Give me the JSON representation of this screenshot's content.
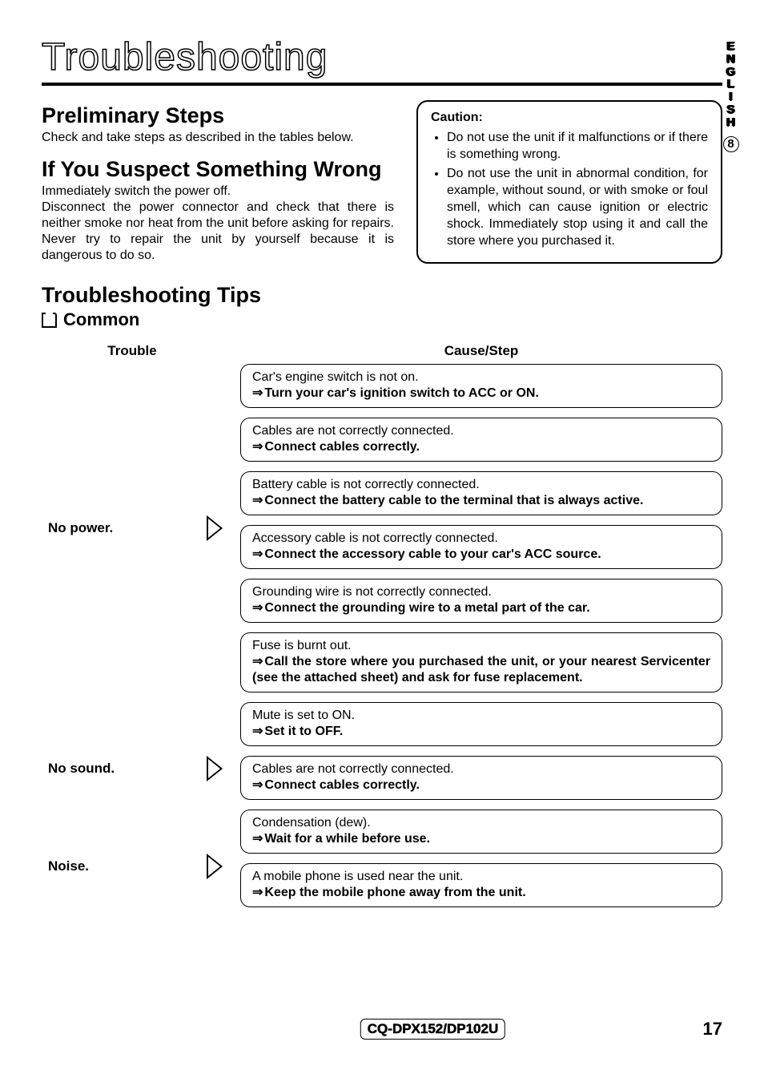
{
  "side_tab": {
    "language": "ENGLISH",
    "index": "8"
  },
  "title": "Troubleshooting",
  "sections": {
    "prelim": {
      "heading": "Preliminary Steps",
      "body": "Check and take steps as described in the tables below."
    },
    "suspect": {
      "heading": "If You Suspect Something Wrong",
      "body": "Immediately switch the power off.\nDisconnect the power connector and check that there is neither smoke nor heat from the unit before asking for repairs. Never try to repair the unit by yourself because it is dangerous to do so."
    }
  },
  "caution": {
    "heading": "Caution:",
    "items": [
      "Do not use the unit if it malfunctions or if there is something wrong.",
      "Do not use the unit in abnormal condition, for example, without sound, or with smoke or foul smell, which can cause ignition or electric shock. Immediately stop using it and call the store where you purchased it."
    ]
  },
  "tips_heading": "Troubleshooting Tips",
  "common_heading": "Common",
  "columns": {
    "trouble": "Trouble",
    "cause": "Cause/Step"
  },
  "troubles": [
    {
      "label": "No power.",
      "causes": [
        {
          "cause": "Car's engine switch is not on.",
          "step": "Turn your car's ignition switch to ACC or ON."
        },
        {
          "cause": "Cables are not correctly connected.",
          "step": "Connect cables correctly."
        },
        {
          "cause": "Battery cable is not correctly connected.",
          "step": "Connect the battery cable to the terminal that is always active."
        },
        {
          "cause": "Accessory cable is not correctly connected.",
          "step": "Connect the accessory cable to your car's ACC source."
        },
        {
          "cause": "Grounding wire is not correctly connected.",
          "step": "Connect the grounding wire to a metal part of the car."
        },
        {
          "cause": "Fuse is burnt out.",
          "step": "Call the store where you purchased the unit, or your nearest Servicenter (see the attached sheet) and ask for fuse replacement.",
          "justify": true
        }
      ]
    },
    {
      "label": "No sound.",
      "causes": [
        {
          "cause": "Mute is set to ON.",
          "step": "Set it to OFF."
        },
        {
          "cause": "Cables are not correctly connected.",
          "step": "Connect cables correctly."
        },
        {
          "cause": "Condensation (dew).",
          "step": "Wait for a while before use."
        }
      ]
    },
    {
      "label": "Noise.",
      "causes": [
        {
          "cause": "A mobile phone is used near the unit.",
          "step": "Keep the mobile phone away from the unit."
        }
      ]
    }
  ],
  "footer": {
    "model": "CQ-DPX152/DP102U",
    "page": "17"
  }
}
